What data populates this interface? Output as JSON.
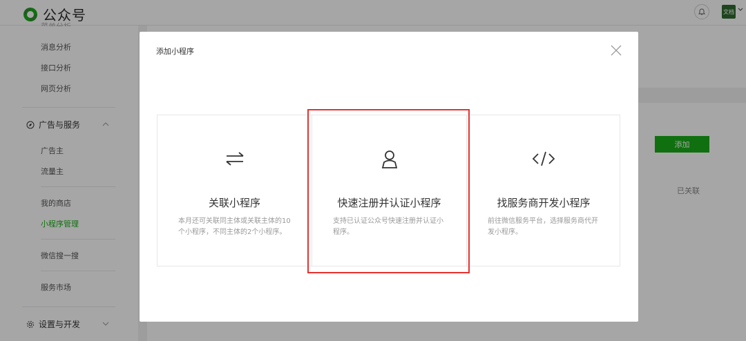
{
  "header": {
    "brand": "公众号",
    "avatar_text": "文档"
  },
  "sidebar": {
    "cut_item": "菜单分析",
    "items_top": [
      "消息分析",
      "接口分析",
      "网页分析"
    ],
    "section_ads": "广告与服务",
    "items_ads": [
      "广告主",
      "流量主"
    ],
    "items_shop": [
      "我的商店",
      "小程序管理"
    ],
    "item_search": "微信搜一搜",
    "item_market": "服务市场",
    "section_settings": "设置与开发"
  },
  "background": {
    "add_button": "添加",
    "linked_status": "已关联"
  },
  "modal": {
    "title": "添加小程序",
    "options": [
      {
        "icon": "link-arrows-icon",
        "title": "关联小程序",
        "desc": "本月还可关联同主体或关联主体的10个小程序，不同主体的2个小程序。"
      },
      {
        "icon": "user-icon",
        "title": "快速注册并认证小程序",
        "desc": "支持已认证公众号快速注册并认证小程序。"
      },
      {
        "icon": "code-icon",
        "title": "找服务商开发小程序",
        "desc": "前往微信服务平台，选择服务商代开发小程序。"
      }
    ]
  },
  "colors": {
    "accent": "#1aad19",
    "highlight": "#e6312e"
  }
}
